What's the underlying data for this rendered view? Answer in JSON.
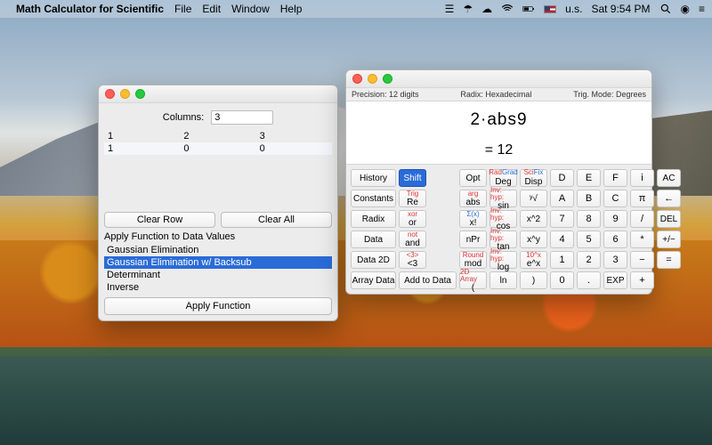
{
  "menubar": {
    "app_name": "Math Calculator for Scientific",
    "items": [
      "File",
      "Edit",
      "Window",
      "Help"
    ],
    "lang": "u.s.",
    "time": "Sat 9:54 PM"
  },
  "matrix": {
    "cols_label": "Columns:",
    "cols_value": "3",
    "rows": [
      [
        "1",
        "2",
        "3"
      ],
      [
        "1",
        "0",
        "0"
      ]
    ],
    "clear_row": "Clear Row",
    "clear_all": "Clear All",
    "apply_label": "Apply Function to Data Values",
    "functions": [
      "Gaussian Elimination",
      "Gaussian Elimination w/ Backsub",
      "Determinant",
      "Inverse"
    ],
    "selected_index": 1,
    "apply_button": "Apply Function"
  },
  "calc": {
    "status": {
      "precision": "Precision: 12 digits",
      "radix": "Radix: Hexadecimal",
      "trig": "Trig. Mode: Degrees"
    },
    "display": {
      "expr": "2·abs9",
      "result": "= 12"
    },
    "left_buttons": [
      "History",
      "Constants",
      "Radix",
      "Data",
      "Data 2D",
      "Array Data"
    ],
    "fn_col1": {
      "shift": "Shift",
      "trig": {
        "sup": "Trig",
        "label": "Re"
      },
      "xor": {
        "sup": "xor",
        "label": "or"
      },
      "not": {
        "sup": "not",
        "label": "and"
      },
      "lt3": {
        "sup": "<3>",
        "label": "<3"
      },
      "add_to_data": "Add to Data"
    },
    "fn_col2": {
      "opt": "Opt",
      "arg": {
        "sup": "arg",
        "label": "abs"
      },
      "zx": {
        "sup": "Σ(x)",
        "label": "x!"
      },
      "npr": "nPr",
      "round": {
        "sup": "Round",
        "label": "mod"
      },
      "array": {
        "sup": "2D Array",
        "label": "("
      }
    },
    "fn_col3": {
      "deg": {
        "sup1": "Rad",
        "sup2": "Grad",
        "label": "Deg"
      },
      "sin": {
        "sup": "Inv: hyp:",
        "label": "sin"
      },
      "cos": {
        "sup": "Inv: hyp:",
        "label": "cos"
      },
      "tan": {
        "sup": "Inv: hyp:",
        "label": "tan"
      },
      "log": {
        "sup": "Inv: hyp:",
        "label": "log"
      },
      "ln": "ln"
    },
    "fn_col4": {
      "disp": {
        "sup1": "Sci",
        "sup2": "Fix",
        "label": "Disp"
      },
      "root": "ʸ√",
      "x2": "x^2",
      "xy": "x^y",
      "tenx": {
        "sup": "10^x",
        "label": "e^x"
      },
      "close": ")"
    },
    "numgrid": {
      "r1": [
        "D",
        "E",
        "F",
        "i",
        "AC"
      ],
      "r2": [
        "A",
        "B",
        "C",
        "π",
        "←"
      ],
      "r3": [
        "7",
        "8",
        "9",
        "/",
        "DEL"
      ],
      "r4": [
        "4",
        "5",
        "6",
        "*",
        "+/−"
      ],
      "r5": [
        "1",
        "2",
        "3",
        "−",
        ""
      ],
      "r6": [
        "0",
        ".",
        "EXP",
        "+",
        "="
      ]
    }
  }
}
